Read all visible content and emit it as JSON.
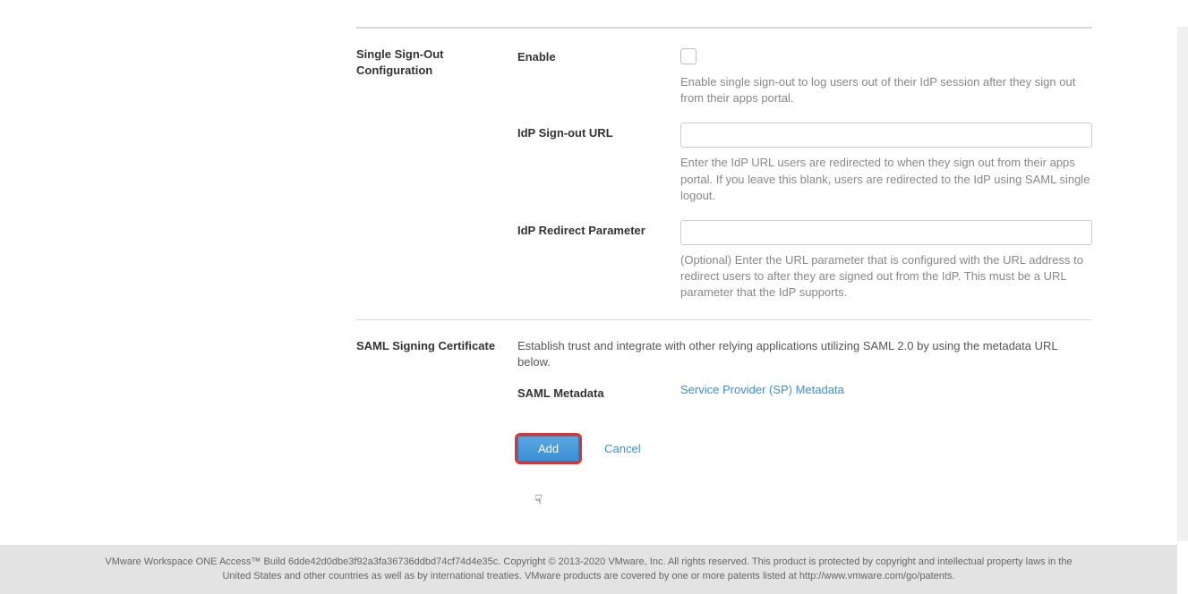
{
  "sections": {
    "sso": {
      "title": "Single Sign-Out Configuration",
      "enable_label": "Enable",
      "enable_help": "Enable single sign-out to log users out of their IdP session after they sign out from their apps portal.",
      "signout_url_label": "IdP Sign-out URL",
      "signout_url_help": "Enter the IdP URL users are redirected to when they sign out from their apps portal. If you leave this blank, users are redirected to the IdP using SAML single logout.",
      "redirect_param_label": "IdP Redirect Parameter",
      "redirect_param_help": "(Optional) Enter the URL parameter that is configured with the URL address to redirect users to after they are signed out from the IdP. This must be a URL parameter that the IdP supports."
    },
    "saml": {
      "title": "SAML Signing Certificate",
      "description": "Establish trust and integrate with other relying applications utilizing SAML 2.0 by using the metadata URL below.",
      "metadata_label": "SAML Metadata",
      "metadata_link": "Service Provider (SP) Metadata"
    }
  },
  "buttons": {
    "add": "Add",
    "cancel": "Cancel"
  },
  "footer": {
    "text": "VMware Workspace ONE Access™ Build 6dde42d0dbe3f92a3fa36736ddbd74cf74d4e35c. Copyright © 2013-2020 VMware, Inc. All rights reserved. This product is protected by copyright and intellectual property laws in the United States and other countries as well as by international treaties. VMware products are covered by one or more patents listed at http://www.vmware.com/go/patents."
  }
}
